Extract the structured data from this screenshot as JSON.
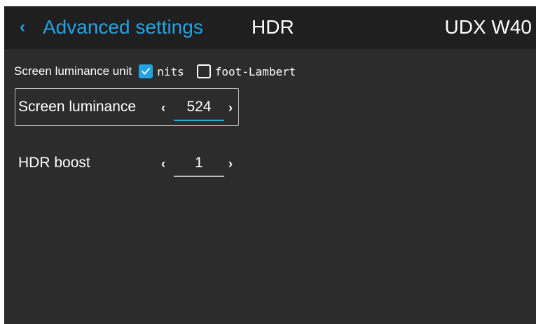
{
  "header": {
    "back_chevron": "‹",
    "back_label": "Advanced settings",
    "title": "HDR",
    "device": "UDX W40"
  },
  "luminance_unit": {
    "label": "Screen luminance unit",
    "options": [
      {
        "label": "nits",
        "checked": true
      },
      {
        "label": "foot-Lambert",
        "checked": false
      }
    ]
  },
  "settings": [
    {
      "label": "Screen luminance",
      "value": "524",
      "left_arrow": "‹",
      "right_arrow": "›",
      "focused": true
    },
    {
      "label": "HDR boost",
      "value": "1",
      "left_arrow": "‹",
      "right_arrow": "›",
      "focused": false
    }
  ],
  "colors": {
    "background": "#2c2c2c",
    "header_background": "#1f1f1f",
    "accent": "#24a3e3",
    "text": "#ffffff",
    "inactive_underline": "#bdbdbd"
  }
}
